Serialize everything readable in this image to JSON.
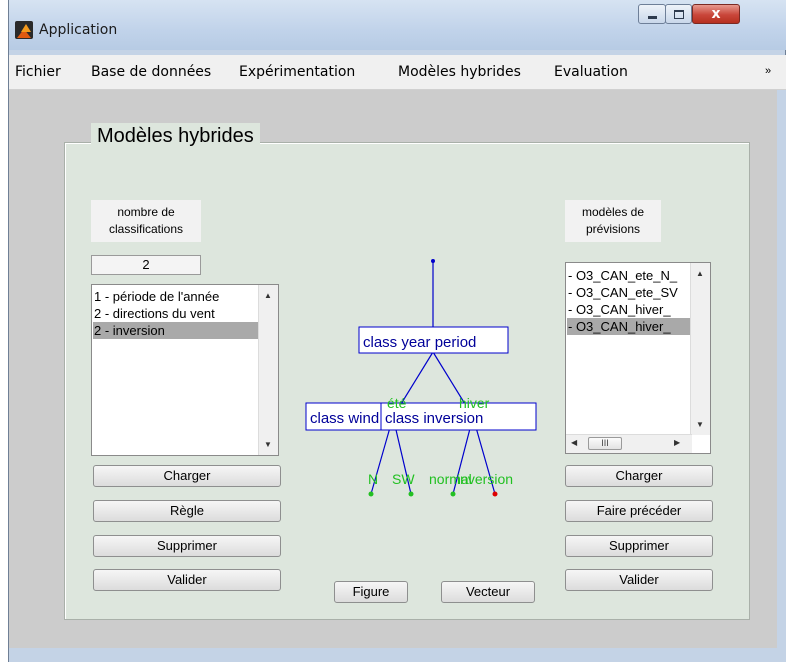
{
  "window": {
    "title": "Application",
    "controls": {
      "close": "x"
    }
  },
  "menu": {
    "items": [
      "Fichier",
      "Base de données",
      "Expérimentation",
      "Modèles hybrides",
      "Evaluation"
    ],
    "overflow": "»"
  },
  "panel": {
    "title": "Modèles hybrides"
  },
  "left": {
    "label_line1": "nombre de",
    "label_line2": "classifications",
    "count": "2",
    "list": [
      "1 - période de l'année",
      "2 - directions du vent",
      "2 - inversion"
    ],
    "selected_index": 2,
    "buttons": [
      "Charger",
      "Règle",
      "Supprimer",
      "Valider"
    ]
  },
  "right": {
    "label_line1": "modèles de",
    "label_line2": "prévisions",
    "list": [
      "- O3_CAN_ete_N_",
      "- O3_CAN_ete_SV",
      "- O3_CAN_hiver_",
      "- O3_CAN_hiver_"
    ],
    "selected_index": 3,
    "scroll_thumb": "III",
    "buttons": [
      "Charger",
      "Faire précéder",
      "Supprimer",
      "Valider"
    ]
  },
  "center": {
    "buttons": {
      "figure": "Figure",
      "vecteur": "Vecteur"
    }
  },
  "tree": {
    "root_node": "class year period",
    "left_node": "class wind direction",
    "right_node": "class inversion",
    "branch_left": "été",
    "branch_right": "hiver",
    "leaves": [
      "N",
      "SW",
      "normal",
      "inversion"
    ],
    "colors": {
      "line": "#0000cc",
      "node_text": "#000099",
      "branch_text": "#22c022",
      "leaf_red": "#dd0000"
    }
  }
}
